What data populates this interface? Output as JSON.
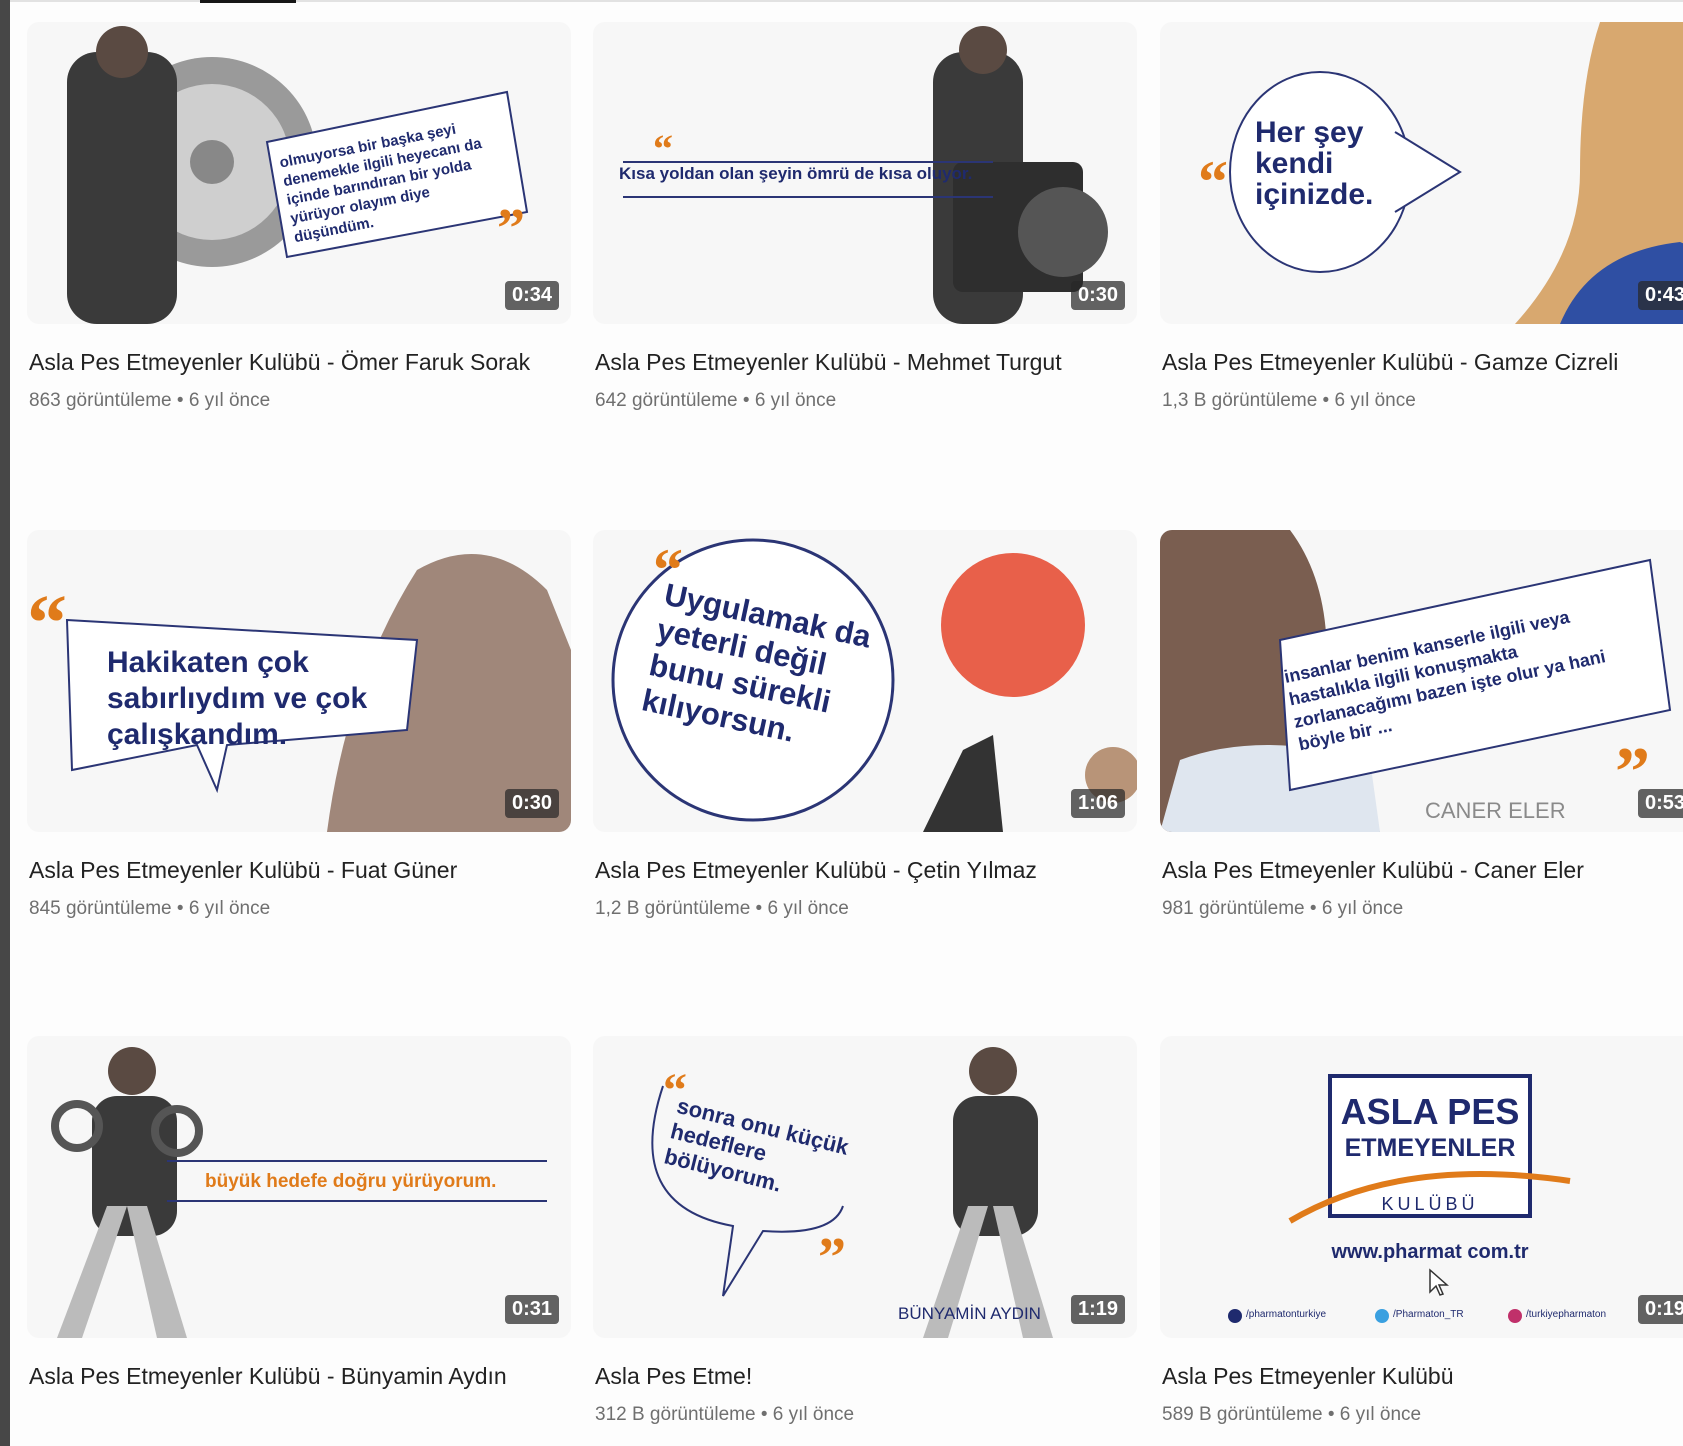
{
  "videos": [
    {
      "title": "Asla Pes Etmeyenler Kulübü - Ömer Faruk Sorak",
      "views": "863 görüntüleme",
      "age": "6 yıl önce",
      "duration": "0:34",
      "quote": "olmuyorsa bir başka şeyi denemekle ilgili heyecanı da içinde barındıran bir yolda yürüyor olayım diye düşündüm."
    },
    {
      "title": "Asla Pes Etmeyenler Kulübü - Mehmet Turgut",
      "views": "642 görüntüleme",
      "age": "6 yıl önce",
      "duration": "0:30",
      "quote": "Kısa yoldan olan şeyin ömrü de kısa oluyor."
    },
    {
      "title": "Asla Pes Etmeyenler Kulübü - Gamze Cizreli",
      "views": "1,3 B görüntüleme",
      "age": "6 yıl önce",
      "duration": "0:43",
      "quote": "Her şey kendi içinizde."
    },
    {
      "title": "Asla Pes Etmeyenler Kulübü - Fuat Güner",
      "views": "845 görüntüleme",
      "age": "6 yıl önce",
      "duration": "0:30",
      "quote": "Hakikaten çok sabırlıydım ve çok çalışkandım."
    },
    {
      "title": "Asla Pes Etmeyenler Kulübü - Çetin Yılmaz",
      "views": "1,2 B görüntüleme",
      "age": "6 yıl önce",
      "duration": "1:06",
      "quote": "Uygulamak da yeterli değil bunu sürekli kılıyorsun."
    },
    {
      "title": "Asla Pes Etmeyenler Kulübü - Caner Eler",
      "views": "981 görüntüleme",
      "age": "6 yıl önce",
      "duration": "0:53",
      "quote": "insanlar benim kanserle ilgili veya hastalıkla ilgili konuşmakta zorlanacağımı bazen işte olur ya hani böyle bir ...",
      "caption": "CANER ELER"
    },
    {
      "title": "Asla Pes Etmeyenler Kulübü - Bünyamin Aydın",
      "views": "",
      "age": "",
      "duration": "0:31",
      "quote": "büyük hedefe doğru yürüyorum."
    },
    {
      "title": "Asla Pes Etme!",
      "views": "312 B görüntüleme",
      "age": "6 yıl önce",
      "duration": "1:19",
      "quote": "sonra onu küçük hedeflere bölüyorum.",
      "caption": "BÜNYAMİN AYDIN"
    },
    {
      "title": "Asla Pes Etmeyenler Kulübü",
      "views": "589 B görüntüleme",
      "age": "6 yıl önce",
      "duration": "0:19",
      "logo_line1": "ASLA PES",
      "logo_line2": "ETMEYENLER",
      "logo_line3": "KULÜBÜ",
      "url": "www.pharmat com.tr",
      "social1": "/pharmatonturkiye",
      "social2": "/Pharmaton_TR",
      "social3": "/turkiyepharmaton"
    }
  ],
  "separator": "•",
  "colors": {
    "navy": "#1f2a6e",
    "orange": "#e07b1a"
  }
}
